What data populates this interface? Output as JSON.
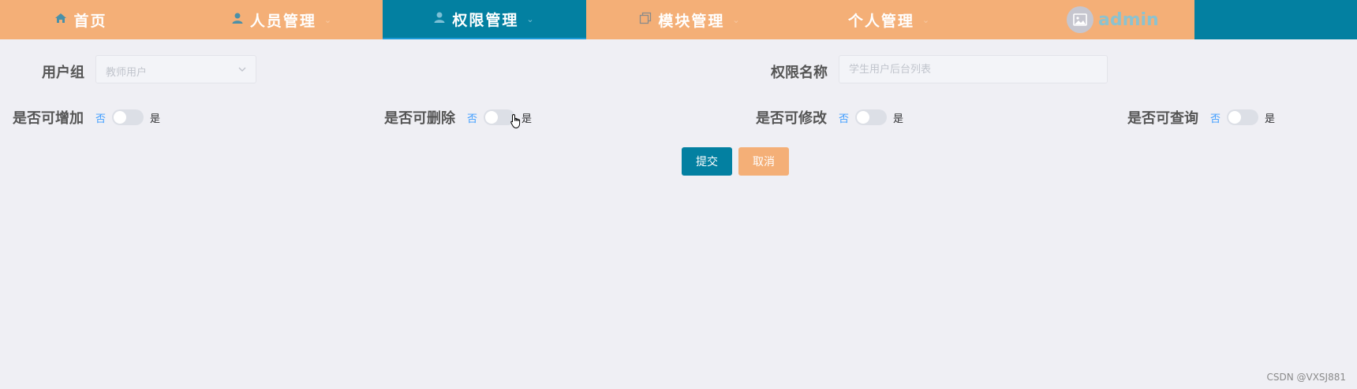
{
  "nav": {
    "items": [
      {
        "label": "首页",
        "icon": "home-icon"
      },
      {
        "label": "人员管理",
        "icon": "user-icon"
      },
      {
        "label": "权限管理",
        "icon": "user-icon"
      },
      {
        "label": "模块管理",
        "icon": "copy-icon"
      },
      {
        "label": "个人管理",
        "icon": ""
      }
    ],
    "active": "权限管理",
    "username": "admin",
    "colors": {
      "bar": "#f4af77",
      "active": "#0380a1"
    }
  },
  "form": {
    "usergroup_label": "用户组",
    "usergroup_value": "教师用户",
    "permname_label": "权限名称",
    "permname_placeholder": "学生用户后台列表",
    "toggles": [
      {
        "label": "是否可增加",
        "off": "否",
        "on": "是"
      },
      {
        "label": "是否可删除",
        "off": "否",
        "on": "是"
      },
      {
        "label": "是否可修改",
        "off": "否",
        "on": "是"
      },
      {
        "label": "是否可查询",
        "off": "否",
        "on": "是"
      }
    ],
    "submit_label": "提交",
    "cancel_label": "取消"
  },
  "watermark": "CSDN @VXSJ881"
}
